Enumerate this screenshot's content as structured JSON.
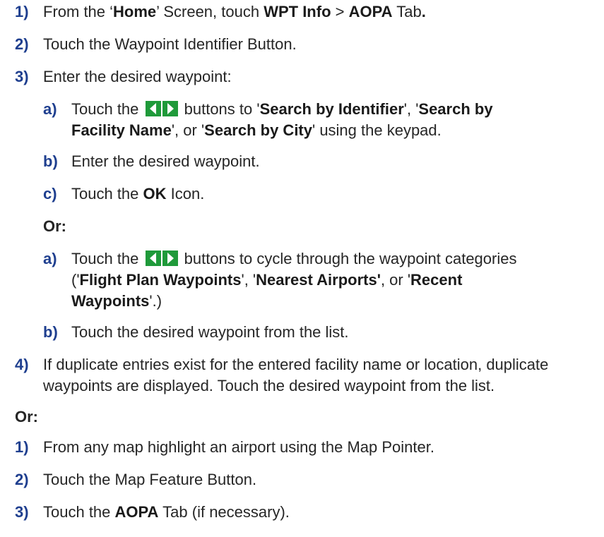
{
  "steps_a": {
    "s1": {
      "num": "1)",
      "t1": "From the ‘",
      "b1": "Home",
      "t2": "’ Screen, touch ",
      "b2": "WPT Info",
      "t3": " > ",
      "b3": "AOPA",
      "t4": " Tab",
      "t5": "."
    },
    "s2": {
      "num": "2)",
      "text": "Touch the Waypoint Identifier Button."
    },
    "s3": {
      "num": "3)",
      "text": "Enter the desired waypoint:"
    },
    "s3a": {
      "num": "a)",
      "t1": "Touch the ",
      "t2": " buttons to '",
      "b1": "Search by Identifier",
      "t3": "', '",
      "b2": "Search by",
      "l2b": "Facility Name",
      "t4": "', or '",
      "b3": "Search by City",
      "t5": "' using the keypad."
    },
    "s3b": {
      "num": "b)",
      "text": "Enter the desired waypoint."
    },
    "s3c": {
      "num": "c)",
      "t1": "Touch the ",
      "b1": "OK",
      "t2": " Icon."
    },
    "or1": "Or:",
    "s3a2": {
      "num": "a)",
      "t1": "Touch the ",
      "t2": " buttons to cycle through the waypoint categories",
      "l2a": "('",
      "b1": "Flight Plan Waypoints",
      "t3": "', '",
      "b2": "Nearest Airports'",
      "t4": ", or '",
      "b3": "Recent",
      "l3b": "Waypoints",
      "t5": "'.)"
    },
    "s3b2": {
      "num": "b)",
      "text": "Touch the desired waypoint from the list."
    },
    "s4": {
      "num": "4)",
      "l1": "If duplicate entries exist for the entered facility name or location, duplicate",
      "l2": "waypoints are displayed.  Touch the desired waypoint from the list."
    }
  },
  "or2": "Or:",
  "steps_b": {
    "s1": {
      "num": "1)",
      "text": "From any map highlight an airport using the Map Pointer."
    },
    "s2": {
      "num": "2)",
      "text": "Touch the Map Feature Button."
    },
    "s3": {
      "num": "3)",
      "t1": "Touch the ",
      "b1": "AOPA",
      "t2": " Tab (if necessary)."
    }
  },
  "colors": {
    "step_number": "#1f3f8f",
    "arrow_button_bg": "#1f9a3a",
    "arrow_fill": "#ffffff",
    "text": "#262626"
  },
  "icons": [
    "left-right-arrow-buttons-icon"
  ]
}
